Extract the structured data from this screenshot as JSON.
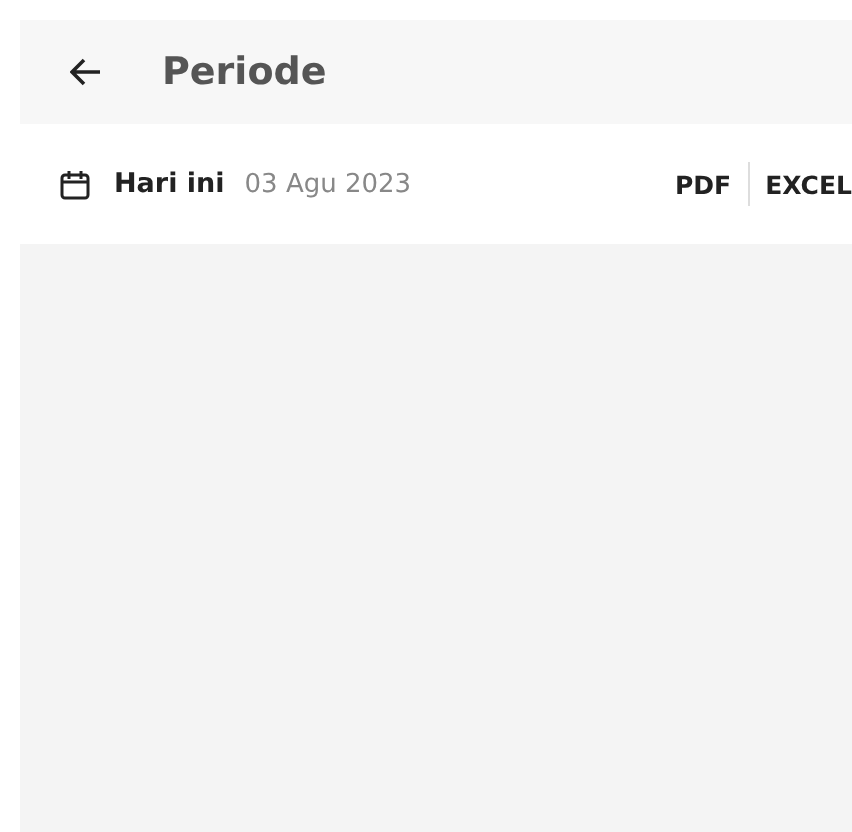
{
  "header": {
    "title": "Periode"
  },
  "period": {
    "label": "Hari ini",
    "date": "03 Agu 2023"
  },
  "exports": [
    "PDF",
    "EXCEL"
  ]
}
